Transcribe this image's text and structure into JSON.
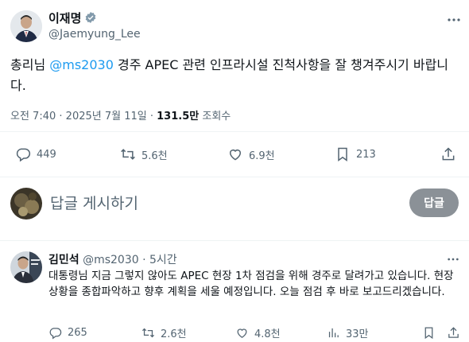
{
  "tweet": {
    "author_name": "이재명",
    "author_handle": "@Jaemyung_Lee",
    "text_before": "총리님 ",
    "mention": "@ms2030",
    "text_after": " 경주 APEC 관련 인프라시설 진척사항을 잘 챙겨주시기 바랍니다.",
    "time": "오전 7:40",
    "date": "2025년 7월 11일",
    "views_count": "131.5만",
    "views_label": "조회수",
    "replies": "449",
    "retweets": "5.6천",
    "likes": "6.9천",
    "bookmarks": "213"
  },
  "composer": {
    "placeholder": "답글 게시하기",
    "reply_button": "답글"
  },
  "reply": {
    "author_name": "김민석",
    "author_handle": "@ms2030",
    "time": "5시간",
    "text": "대통령님 지금 그렇지 않아도 APEC 현장 1차 점검을 위해 경주로 달려가고 있습니다. 현장상황을 종합파악하고 향후 계획을 세울 예정입니다. 오늘 점검 후 바로 보고드리겠습니다.",
    "replies": "265",
    "retweets": "2.6천",
    "likes": "4.8천",
    "views": "33만"
  },
  "colors": {
    "accent": "#1d9bf0",
    "muted": "#536471",
    "verified": "#829aab",
    "reply_button": "#8b9197"
  },
  "icons": [
    "verified-badge-icon",
    "more-icon",
    "reply-icon",
    "retweet-icon",
    "like-icon",
    "bookmark-icon",
    "share-icon",
    "views-icon"
  ]
}
